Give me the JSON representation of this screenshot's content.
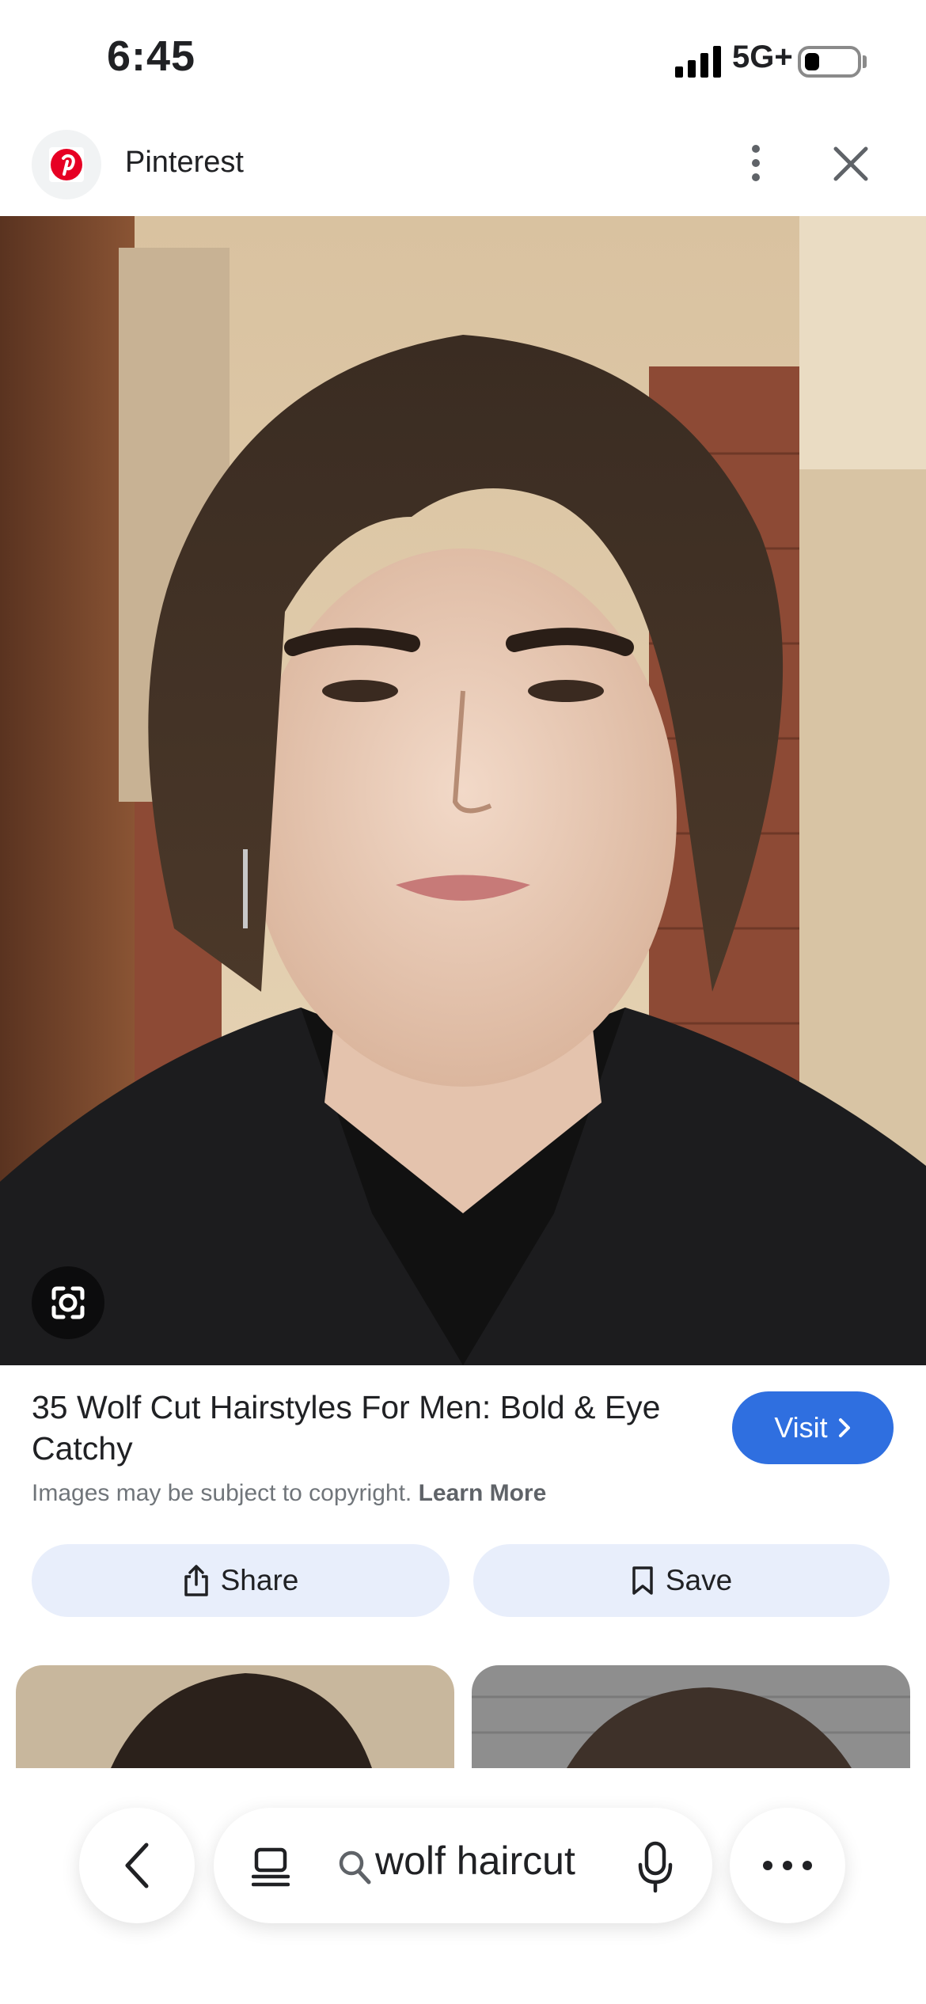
{
  "status_bar": {
    "time": "6:45",
    "network": "5G+"
  },
  "header": {
    "source_name": "Pinterest"
  },
  "result": {
    "title": "35 Wolf Cut Hairstyles For Men: Bold & Eye Catchy",
    "visit_label": "Visit",
    "copyright_text": "Images may be subject to copyright.",
    "learn_more_label": "Learn More",
    "share_label": "Share",
    "save_label": "Save"
  },
  "bottom_bar": {
    "search_query": "wolf haircut"
  },
  "icons": [
    "pinterest-logo",
    "more-vert-icon",
    "close-icon",
    "lens-icon",
    "chevron-right-icon",
    "share-icon",
    "bookmark-icon",
    "back-chevron-icon",
    "tabs-icon",
    "search-icon",
    "mic-icon",
    "more-horiz-icon"
  ],
  "colors": {
    "accent": "#2f6fe0",
    "pill_bg": "#e8eefb",
    "pinterest_red": "#e60023"
  }
}
